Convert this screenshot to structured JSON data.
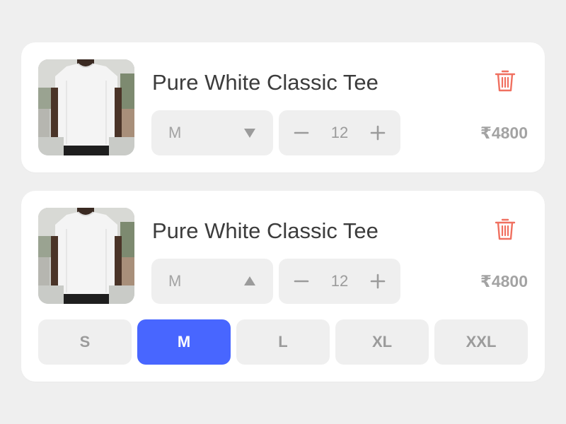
{
  "colors": {
    "background": "#efefef",
    "card": "#ffffff",
    "accent": "#4866ff",
    "delete": "#f07060",
    "muted_text": "#a3a3a3"
  },
  "cart_items": [
    {
      "image_icon": "white-tshirt-photo",
      "title": "Pure White Classic Tee",
      "size": "M",
      "dropdown_icon": "caret-down-icon",
      "quantity": "12",
      "price": "₹4800",
      "delete_icon": "trash-icon"
    },
    {
      "image_icon": "white-tshirt-photo",
      "title": "Pure White Classic Tee",
      "size": "M",
      "dropdown_icon": "caret-up-icon",
      "quantity": "12",
      "price": "₹4800",
      "delete_icon": "trash-icon",
      "size_options": [
        "S",
        "M",
        "L",
        "XL",
        "XXL"
      ],
      "selected_size": "M"
    }
  ]
}
